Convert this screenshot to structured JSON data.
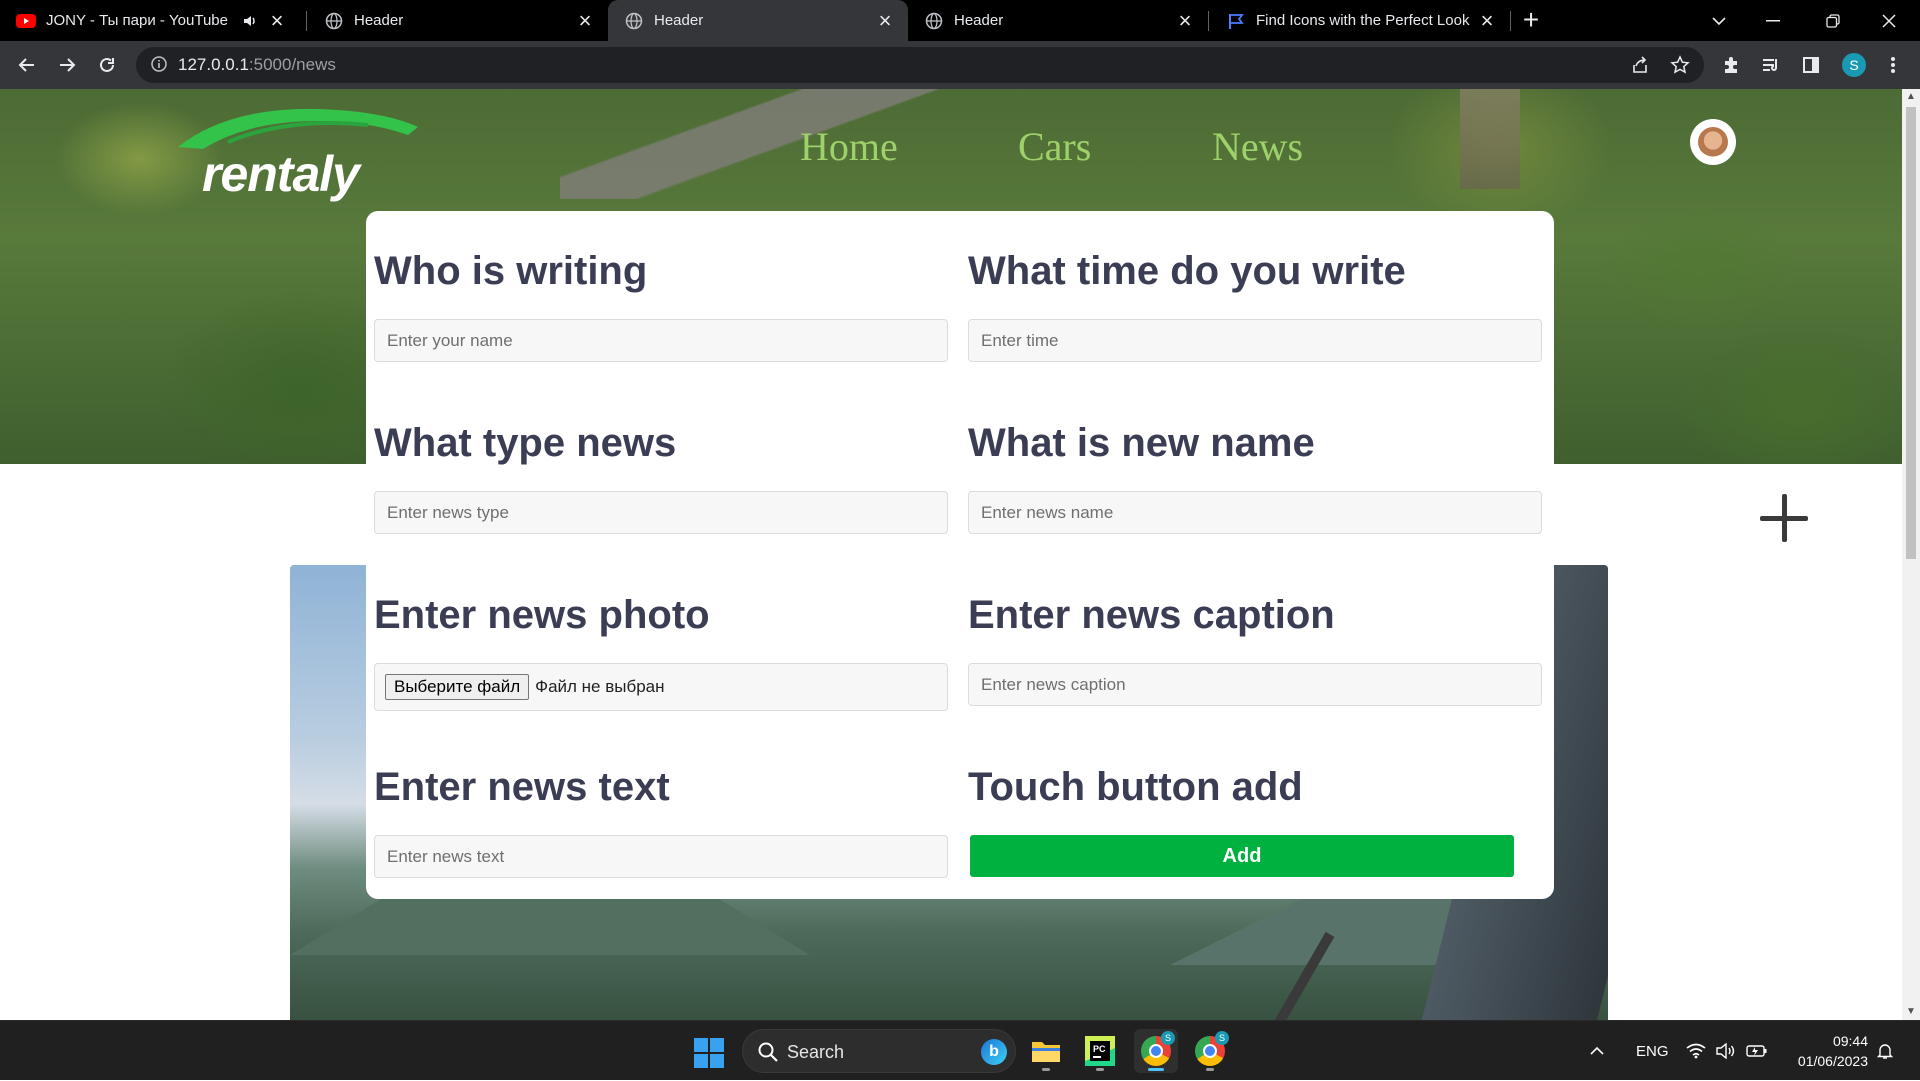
{
  "browser": {
    "tabs": [
      {
        "title": "JONY - Ты пари - YouTube",
        "favicon": "youtube-icon",
        "audio": true,
        "active": false
      },
      {
        "title": "Header",
        "favicon": "globe-icon",
        "active": false
      },
      {
        "title": "Header",
        "favicon": "globe-icon",
        "active": true
      },
      {
        "title": "Header",
        "favicon": "globe-icon",
        "active": false
      },
      {
        "title": "Find Icons with the Perfect Look",
        "favicon": "flag-icon",
        "active": false
      }
    ],
    "url_host": "127.0.0.1",
    "url_path": ":5000/news",
    "profile_initial": "S"
  },
  "site": {
    "logo_text": "rentaly",
    "nav": [
      "Home",
      "Cars",
      "News"
    ]
  },
  "form": {
    "fields": [
      {
        "heading": "Who is writing",
        "placeholder": "Enter your name"
      },
      {
        "heading": "What time do you write",
        "placeholder": "Enter time"
      },
      {
        "heading": "What type news",
        "placeholder": "Enter news type"
      },
      {
        "heading": "What is new name",
        "placeholder": "Enter news name"
      },
      {
        "heading": "Enter news photo",
        "file_button": "Выберите файл",
        "file_status": "Файл не выбран"
      },
      {
        "heading": "Enter news caption",
        "placeholder": "Enter news caption"
      },
      {
        "heading": "Enter news text",
        "placeholder": "Enter news text"
      },
      {
        "heading": "Touch button add",
        "button": "Add"
      }
    ],
    "accent_color": "#00b140",
    "heading_color": "#3b3d54"
  },
  "taskbar": {
    "search_label": "Search",
    "language": "ENG",
    "time": "09:44",
    "date": "01/06/2023"
  }
}
